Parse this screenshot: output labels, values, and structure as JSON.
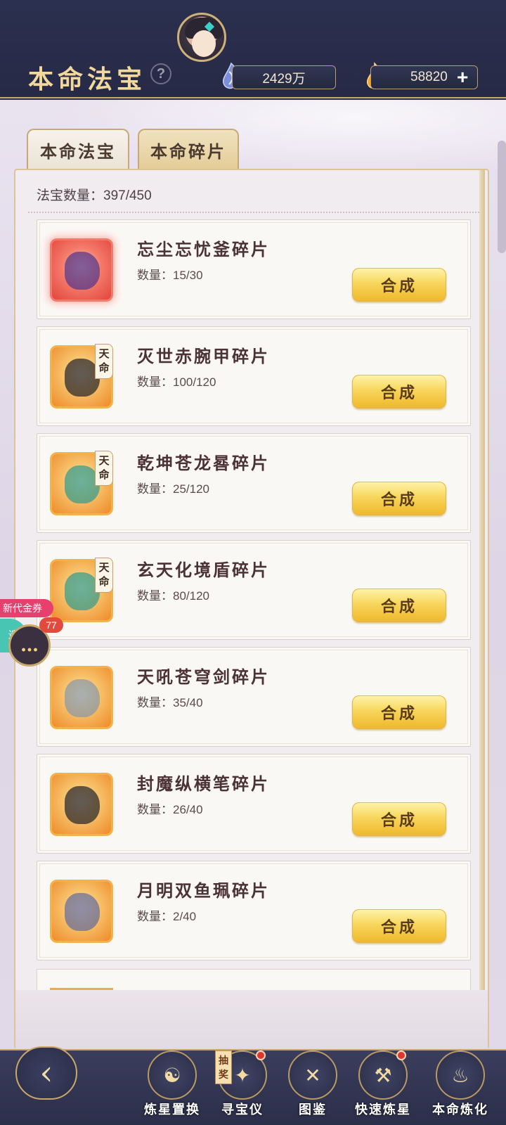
{
  "header": {
    "title": "本命法宝",
    "help_icon": "?",
    "currency1": "2429万",
    "currency2": "58820",
    "plus_label": "+"
  },
  "tabs": [
    {
      "label": "本命法宝"
    },
    {
      "label": "本命碎片"
    }
  ],
  "summary": {
    "count_label": "法宝数量：397/450"
  },
  "items": [
    {
      "name": "忘尘忘忧釜碎片",
      "count": "数量：15/30",
      "button": "合成",
      "tianming": ""
    },
    {
      "name": "灭世赤腕甲碎片",
      "count": "数量：100/120",
      "button": "合成",
      "tianming": "天命"
    },
    {
      "name": "乾坤苍龙晷碎片",
      "count": "数量：25/120",
      "button": "合成",
      "tianming": "天命"
    },
    {
      "name": "玄天化境盾碎片",
      "count": "数量：80/120",
      "button": "合成",
      "tianming": "天命"
    },
    {
      "name": "天吼苍穹剑碎片",
      "count": "数量：35/40",
      "button": "合成",
      "tianming": ""
    },
    {
      "name": "封魔纵横笔碎片",
      "count": "数量：26/40",
      "button": "合成",
      "tianming": ""
    },
    {
      "name": "月明双鱼珮碎片",
      "count": "数量：2/40",
      "button": "合成",
      "tianming": ""
    }
  ],
  "floating": {
    "promo": "新代金券",
    "badge": "77",
    "teal_text": "遗"
  },
  "bottom_nav": [
    {
      "label": "炼星置换"
    },
    {
      "label": "寻宝仪",
      "tag": "抽奖"
    },
    {
      "label": "图鉴"
    },
    {
      "label": "快速炼星"
    },
    {
      "label": "本命炼化"
    }
  ],
  "colors": {
    "header_bg": "#2c3050",
    "accent_gold": "#c9a86a",
    "button_gold": "#f8d65c"
  }
}
